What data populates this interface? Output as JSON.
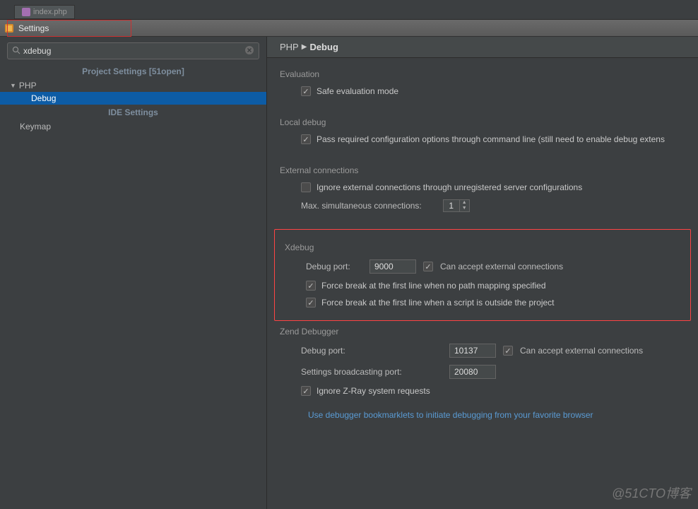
{
  "topTab": {
    "label": "index.php"
  },
  "window": {
    "title": "Settings"
  },
  "search": {
    "value": "xdebug"
  },
  "sidebar": {
    "headerProject": "Project Settings [51open]",
    "headerIDE": "IDE Settings",
    "items": {
      "php": "PHP",
      "debug": "Debug",
      "keymap": "Keymap"
    }
  },
  "breadcrumb": {
    "a": "PHP",
    "b": "Debug"
  },
  "evaluation": {
    "title": "Evaluation",
    "safe": "Safe evaluation mode"
  },
  "localdebug": {
    "title": "Local debug",
    "pass": "Pass required configuration options through command line (still need to enable debug extens"
  },
  "external": {
    "title": "External connections",
    "ignore": "Ignore external connections through unregistered server configurations",
    "maxLabel": "Max. simultaneous connections:",
    "maxVal": "1"
  },
  "xdebug": {
    "title": "Xdebug",
    "portLabel": "Debug port:",
    "portVal": "9000",
    "accept": "Can accept external connections",
    "force1": "Force break at the first line when no path mapping specified",
    "force2": "Force break at the first line when a script is outside the project"
  },
  "zend": {
    "title": "Zend Debugger",
    "portLabel": "Debug port:",
    "portVal": "10137",
    "accept": "Can accept external connections",
    "broadcastLabel": "Settings broadcasting port:",
    "broadcastVal": "20080",
    "zray": "Ignore Z-Ray system requests"
  },
  "link": "Use debugger bookmarklets to initiate debugging from your favorite browser",
  "watermark": "@51CTO博客"
}
